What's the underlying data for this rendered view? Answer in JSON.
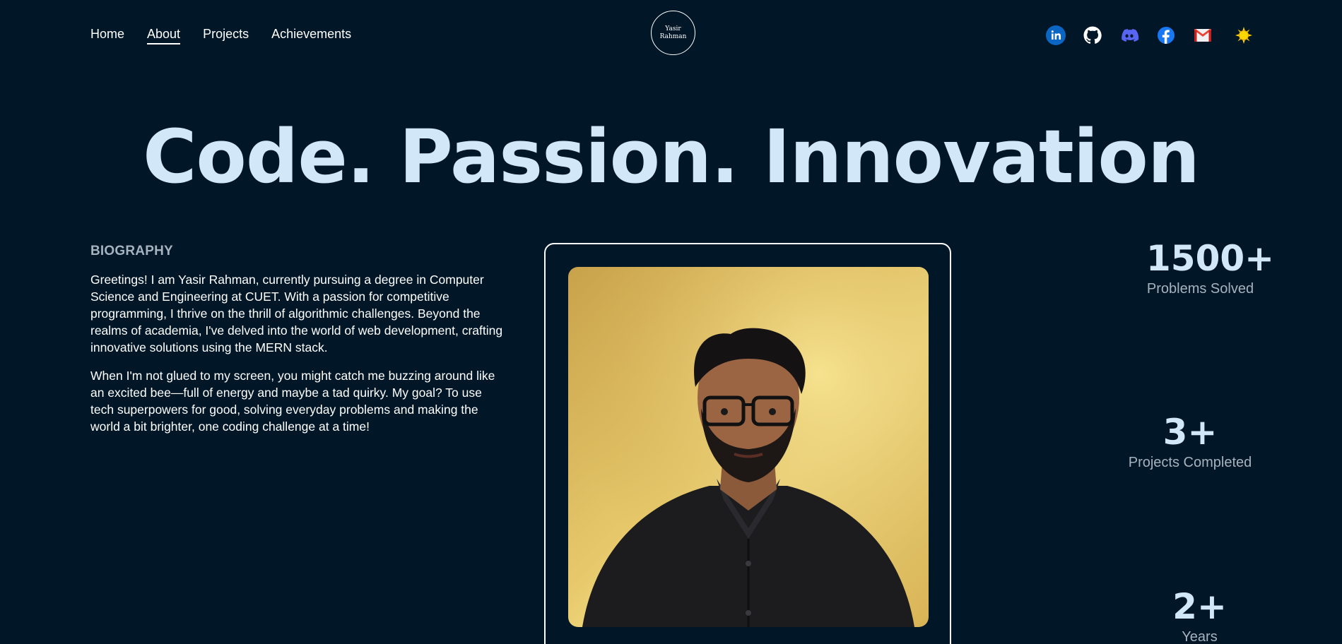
{
  "nav": {
    "links": [
      {
        "label": "Home",
        "active": false
      },
      {
        "label": "About",
        "active": true
      },
      {
        "label": "Projects",
        "active": false
      },
      {
        "label": "Achievements",
        "active": false
      }
    ],
    "logo": {
      "line1": "Yasir",
      "line2": "Rahman"
    },
    "socials": [
      {
        "icon": "linkedin-icon",
        "color": "#0a66c2"
      },
      {
        "icon": "github-icon",
        "color": "#ffffff"
      },
      {
        "icon": "discord-icon",
        "color": "#5865f2"
      },
      {
        "icon": "facebook-icon",
        "color": "#1877f2"
      },
      {
        "icon": "gmail-icon",
        "color": "#ea4335"
      },
      {
        "icon": "sun-icon",
        "color": "#ffd700"
      }
    ]
  },
  "hero": {
    "headline": "Code. Passion. Innovation"
  },
  "biography": {
    "title": "BIOGRAPHY",
    "paragraphs": [
      "Greetings! I am Yasir Rahman, currently pursuing a degree in Computer Science and Engineering at CUET. With a passion for competitive programming, I thrive on the thrill of algorithmic challenges. Beyond the realms of academia, I've delved into the world of web development, crafting innovative solutions using the MERN stack.",
      "When I'm not glued to my screen, you might catch me buzzing around like an excited bee—full of energy and maybe a tad quirky. My goal? To use tech superpowers for good, solving everyday problems and making the world a bit brighter, one coding challenge at a time!"
    ]
  },
  "stats": [
    {
      "value": "1500+",
      "label": "Problems Solved"
    },
    {
      "value": "3+",
      "label": "Projects Completed"
    },
    {
      "value": "2+",
      "label": "Years Experience"
    }
  ],
  "colors": {
    "background": "#011627",
    "headline": "#d2e7f7",
    "muted": "#a7b2bf"
  }
}
